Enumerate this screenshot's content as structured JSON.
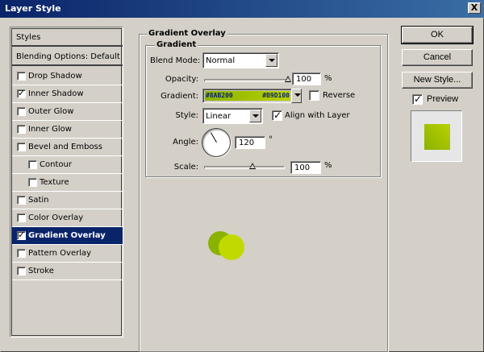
{
  "window": {
    "title": "Layer Style",
    "close_glyph": "X"
  },
  "styles_list": {
    "header": "Styles",
    "blending": "Blending Options: Default",
    "items": [
      {
        "label": "Drop Shadow",
        "checked": false,
        "indent": false
      },
      {
        "label": "Inner Shadow",
        "checked": true,
        "indent": false
      },
      {
        "label": "Outer Glow",
        "checked": false,
        "indent": false
      },
      {
        "label": "Inner Glow",
        "checked": false,
        "indent": false
      },
      {
        "label": "Bevel and Emboss",
        "checked": false,
        "indent": false
      },
      {
        "label": "Contour",
        "checked": false,
        "indent": true
      },
      {
        "label": "Texture",
        "checked": false,
        "indent": true
      },
      {
        "label": "Satin",
        "checked": false,
        "indent": false
      },
      {
        "label": "Color Overlay",
        "checked": false,
        "indent": false
      },
      {
        "label": "Gradient Overlay",
        "checked": true,
        "indent": false,
        "selected": true
      },
      {
        "label": "Pattern Overlay",
        "checked": false,
        "indent": false
      },
      {
        "label": "Stroke",
        "checked": false,
        "indent": false
      }
    ]
  },
  "panel": {
    "title": "Gradient Overlay",
    "group": "Gradient",
    "blend_mode": {
      "label": "Blend Mode:",
      "value": "Normal"
    },
    "opacity": {
      "label": "Opacity:",
      "value": "100",
      "unit": "%",
      "level": 1.0
    },
    "gradient": {
      "label": "Gradient:",
      "start_code": "#8AB200",
      "end_code": "#B9D100",
      "start_color": "#8AB200",
      "end_color": "#B9D100"
    },
    "reverse": {
      "label": "Reverse",
      "checked": false
    },
    "style": {
      "label": "Style:",
      "value": "Linear"
    },
    "align": {
      "label": "Align with Layer",
      "checked": true
    },
    "angle": {
      "label": "Angle:",
      "value": "120",
      "unit": "°",
      "degrees": 120
    },
    "scale": {
      "label": "Scale:",
      "value": "100",
      "unit": "%",
      "level": 0.6
    }
  },
  "buttons": {
    "ok": "OK",
    "cancel": "Cancel",
    "new_style": "New Style..."
  },
  "preview": {
    "label": "Preview",
    "checked": true
  },
  "colors": {
    "titlebar": "#0a246a",
    "dot_dark": "#8AB200",
    "dot_light": "#C2D900"
  }
}
